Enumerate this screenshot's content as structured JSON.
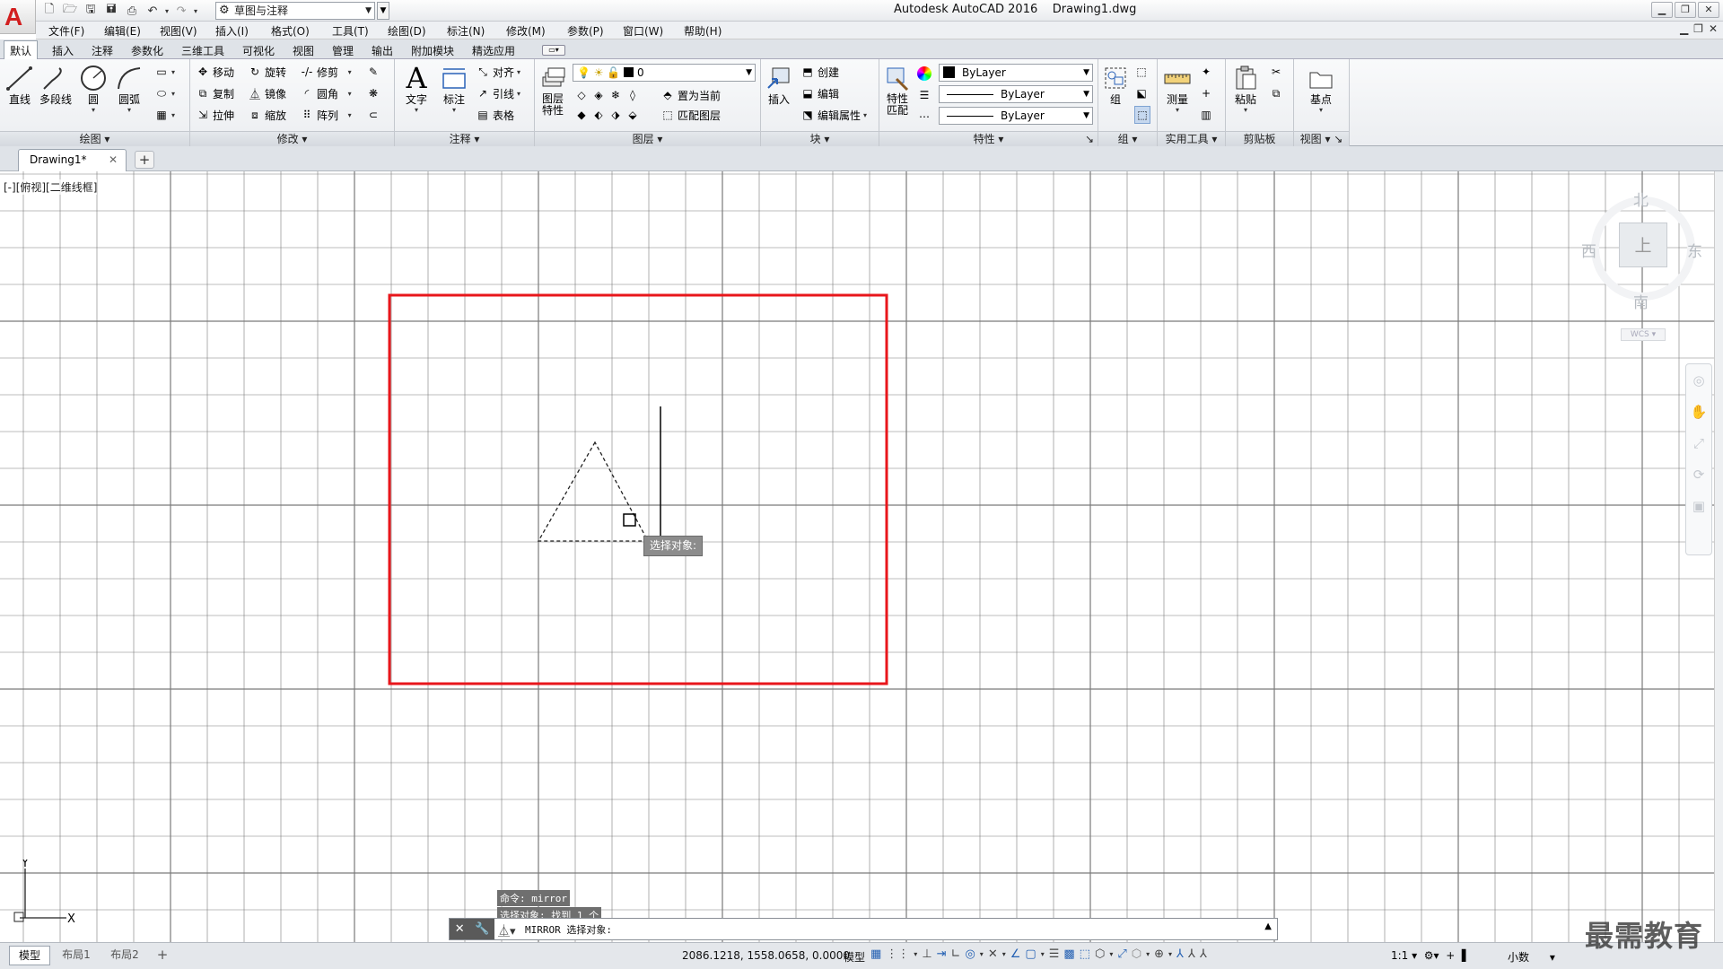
{
  "title_bar": {
    "app_name": "Autodesk AutoCAD 2016",
    "file_name": "Drawing1.dwg",
    "workspace": "草图与注释",
    "logo_letter": "A"
  },
  "menu": [
    "文件(F)",
    "编辑(E)",
    "视图(V)",
    "插入(I)",
    "格式(O)",
    "工具(T)",
    "绘图(D)",
    "标注(N)",
    "修改(M)",
    "参数(P)",
    "窗口(W)",
    "帮助(H)"
  ],
  "ribbon_tabs": [
    "默认",
    "插入",
    "注释",
    "参数化",
    "三维工具",
    "可视化",
    "视图",
    "管理",
    "输出",
    "附加模块",
    "精选应用"
  ],
  "ribbon": {
    "draw": {
      "title": "绘图",
      "line": "直线",
      "polyline": "多段线",
      "circle": "圆",
      "arc": "圆弧"
    },
    "modify": {
      "title": "修改",
      "move": "移动",
      "rotate": "旋转",
      "trim": "修剪",
      "copy": "复制",
      "mirror": "镜像",
      "fillet": "圆角",
      "stretch": "拉伸",
      "scale": "缩放",
      "array": "阵列"
    },
    "annotation": {
      "title": "注释",
      "text": "文字",
      "dimension": "标注",
      "align": "对齐",
      "leader": "引线",
      "table": "表格"
    },
    "layers": {
      "title": "图层",
      "properties": "图层\n特性",
      "current_layer": "0",
      "set_current": "置为当前",
      "match_layer": "匹配图层"
    },
    "block": {
      "title": "块",
      "insert": "插入",
      "create": "创建",
      "edit": "编辑",
      "edit_attr": "编辑属性"
    },
    "properties": {
      "title": "特性",
      "match": "特性\n匹配",
      "color": "ByLayer",
      "linetype": "ByLayer",
      "lineweight": "ByLayer"
    },
    "groups": {
      "title": "组",
      "group": "组"
    },
    "utilities": {
      "title": "实用工具",
      "measure": "测量"
    },
    "clipboard": {
      "title": "剪贴板",
      "paste": "粘贴"
    },
    "view": {
      "title": "视图",
      "base": "基点"
    }
  },
  "doc_tab": {
    "name": "Drawing1*",
    "new": "+"
  },
  "viewport_label": "[-][俯视][二维线框]",
  "viewcube": {
    "n": "北",
    "s": "南",
    "e": "东",
    "w": "西",
    "top": "上",
    "wcs": "WCS"
  },
  "tooltip": "选择对象:",
  "command": {
    "history": [
      "命令: mirror",
      "选择对象: 找到 1 个"
    ],
    "prompt": "MIRROR 选择对象:"
  },
  "ucs": {
    "x": "X",
    "y": "Y"
  },
  "layout_tabs": [
    "模型",
    "布局1",
    "布局2"
  ],
  "status": {
    "coords": "2086.1218, 1558.0658, 0.0000",
    "model": "模型",
    "scale": "1:1",
    "units": "小数"
  },
  "watermark": "最需教育",
  "colors": {
    "highlight_box": "#e8161b",
    "grid": "#7a7a7a",
    "accent_red": "#d21f1f"
  }
}
